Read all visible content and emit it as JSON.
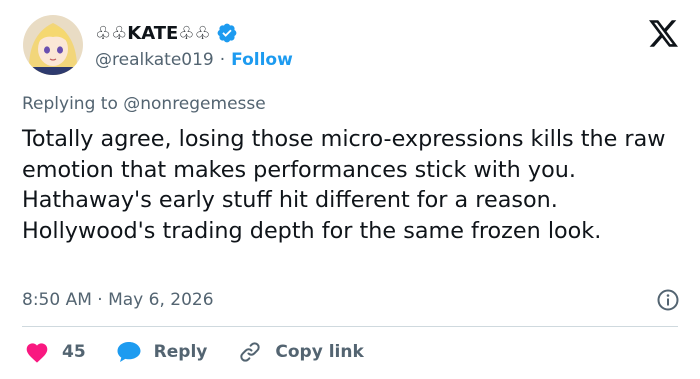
{
  "author": {
    "display_name": "♧♧KATE♧♧",
    "handle": "@realkate019",
    "separator": "·",
    "follow_label": "Follow"
  },
  "reply_context": "Replying to @nonregemesse",
  "tweet": {
    "text": "Totally agree, losing those micro-expressions kills the raw emotion that makes performances stick with you. Hathaway's early stuff hit different for a reason. Hollywood's trading depth for the same frozen look."
  },
  "meta": {
    "timestamp": "8:50 AM · May 6, 2026"
  },
  "actions": {
    "like_count": "45",
    "reply_label": "Reply",
    "copy_link_label": "Copy link"
  },
  "icons": {
    "verified": "verified-badge-icon",
    "x_logo": "x-logo-icon",
    "info": "info-icon",
    "heart": "heart-icon",
    "reply": "speech-bubble-icon",
    "link": "link-icon"
  },
  "colors": {
    "accent": "#1d9bf0",
    "like": "#f91880",
    "muted": "#536471",
    "text": "#0f1419"
  }
}
